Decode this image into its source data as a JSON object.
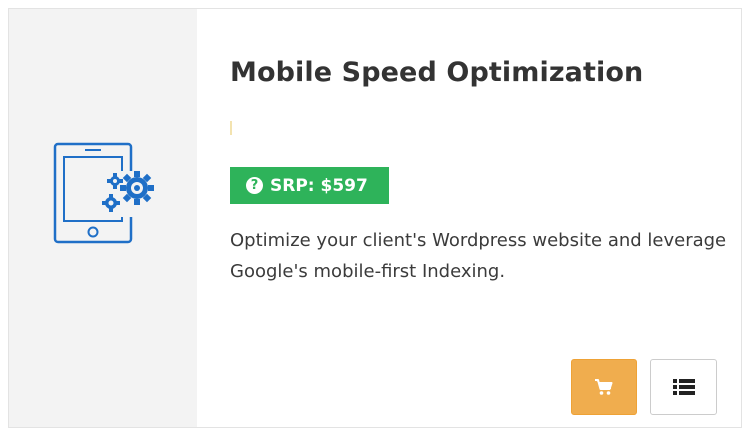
{
  "product": {
    "title": "Mobile Speed Optimization",
    "srp_label": "SRP: $597",
    "help_icon_glyph": "?",
    "description": "Optimize your client's Wordpress website and leverage Google's mobile-first Indexing.",
    "image_icon": "tablet-gears-icon"
  },
  "actions": {
    "cart_icon": "cart-icon",
    "details_icon": "list-icon"
  },
  "colors": {
    "image_panel_bg": "#f3f3f3",
    "icon_blue": "#1f6fc7",
    "srp_green": "#2eb35a",
    "cart_orange": "#f0ad4e",
    "title_text": "#333333"
  }
}
